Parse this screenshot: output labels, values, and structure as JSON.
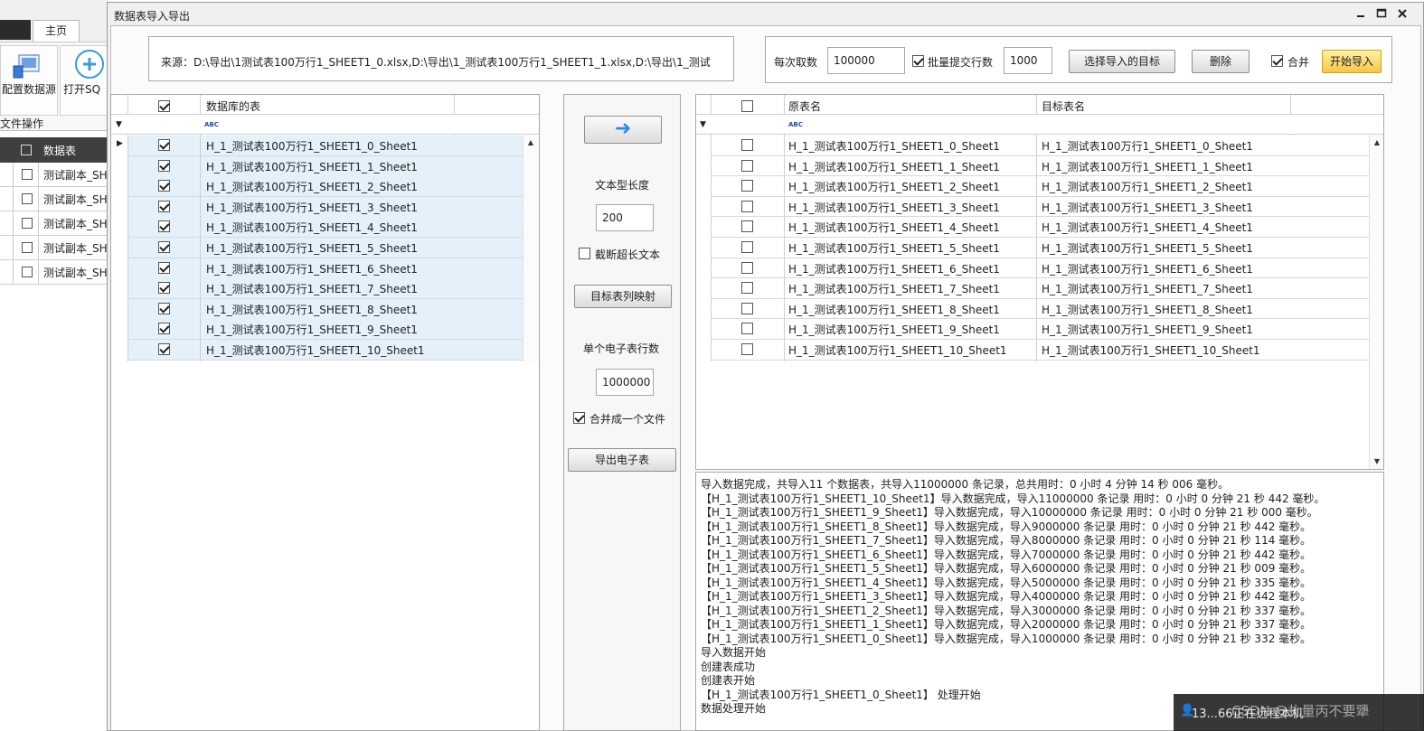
{
  "bg_app": {
    "tab_home": "主页",
    "btn_config": "配置数据源",
    "btn_open": "打开SQ",
    "group_label": "文件操作",
    "grid_header": "数据表",
    "rows": [
      "测试副本_SH",
      "测试副本_SH",
      "测试副本_SH",
      "测试副本_SH",
      "测试副本_SH"
    ]
  },
  "dialog": {
    "title": "数据表导入导出",
    "source_label": "来源：D:\\导出\\1测试表100万行1_SHEET1_0.xlsx,D:\\导出\\1_测试表100万行1_SHEET1_1.xlsx,D:\\导出\\1_测试",
    "batch_label": "每次取数",
    "batch_value": "100000",
    "bulk_label": "批量提交行数",
    "bulk_value": "1000",
    "choose_target": "选择导入的目标",
    "delete": "删除",
    "merge_label": "合并",
    "start_import": "开始导入"
  },
  "left_grid": {
    "header": "数据库的表",
    "rows": [
      "H_1_测试表100万行1_SHEET1_0_Sheet1",
      "H_1_测试表100万行1_SHEET1_1_Sheet1",
      "H_1_测试表100万行1_SHEET1_2_Sheet1",
      "H_1_测试表100万行1_SHEET1_3_Sheet1",
      "H_1_测试表100万行1_SHEET1_4_Sheet1",
      "H_1_测试表100万行1_SHEET1_5_Sheet1",
      "H_1_测试表100万行1_SHEET1_6_Sheet1",
      "H_1_测试表100万行1_SHEET1_7_Sheet1",
      "H_1_测试表100万行1_SHEET1_8_Sheet1",
      "H_1_测试表100万行1_SHEET1_9_Sheet1",
      "H_1_测试表100万行1_SHEET1_10_Sheet1"
    ]
  },
  "middle": {
    "arrow": "➜",
    "text_length_label": "文本型长度",
    "text_length_value": "200",
    "truncate_label": "截断超长文本",
    "column_map": "目标表列映射",
    "rows_per_sheet_label": "单个电子表行数",
    "rows_per_sheet_value": "1000000",
    "merge_file_label": "合并成一个文件",
    "export": "导出电子表"
  },
  "right_grid": {
    "header_source": "原表名",
    "header_target": "目标表名",
    "rows": [
      [
        "H_1_测试表100万行1_SHEET1_0_Sheet1",
        "H_1_测试表100万行1_SHEET1_0_Sheet1"
      ],
      [
        "H_1_测试表100万行1_SHEET1_1_Sheet1",
        "H_1_测试表100万行1_SHEET1_1_Sheet1"
      ],
      [
        "H_1_测试表100万行1_SHEET1_2_Sheet1",
        "H_1_测试表100万行1_SHEET1_2_Sheet1"
      ],
      [
        "H_1_测试表100万行1_SHEET1_3_Sheet1",
        "H_1_测试表100万行1_SHEET1_3_Sheet1"
      ],
      [
        "H_1_测试表100万行1_SHEET1_4_Sheet1",
        "H_1_测试表100万行1_SHEET1_4_Sheet1"
      ],
      [
        "H_1_测试表100万行1_SHEET1_5_Sheet1",
        "H_1_测试表100万行1_SHEET1_5_Sheet1"
      ],
      [
        "H_1_测试表100万行1_SHEET1_6_Sheet1",
        "H_1_测试表100万行1_SHEET1_6_Sheet1"
      ],
      [
        "H_1_测试表100万行1_SHEET1_7_Sheet1",
        "H_1_测试表100万行1_SHEET1_7_Sheet1"
      ],
      [
        "H_1_测试表100万行1_SHEET1_8_Sheet1",
        "H_1_测试表100万行1_SHEET1_8_Sheet1"
      ],
      [
        "H_1_测试表100万行1_SHEET1_9_Sheet1",
        "H_1_测试表100万行1_SHEET1_9_Sheet1"
      ],
      [
        "H_1_测试表100万行1_SHEET1_10_Sheet1",
        "H_1_测试表100万行1_SHEET1_10_Sheet1"
      ]
    ]
  },
  "log": [
    "导入数据完成，共导入11 个数据表，共导入11000000 条记录，总共用时：0 小时 4 分钟 14 秒 006 毫秒。",
    "【H_1_测试表100万行1_SHEET1_10_Sheet1】导入数据完成，导入11000000 条记录 用时：0 小时 0 分钟 21 秒 442 毫秒。",
    "【H_1_测试表100万行1_SHEET1_9_Sheet1】导入数据完成，导入10000000 条记录 用时：0 小时 0 分钟 21 秒 000 毫秒。",
    "【H_1_测试表100万行1_SHEET1_8_Sheet1】导入数据完成，导入9000000 条记录 用时：0 小时 0 分钟 21 秒 442 毫秒。",
    "【H_1_测试表100万行1_SHEET1_7_Sheet1】导入数据完成，导入8000000 条记录 用时：0 小时 0 分钟 21 秒 114 毫秒。",
    "【H_1_测试表100万行1_SHEET1_6_Sheet1】导入数据完成，导入7000000 条记录 用时：0 小时 0 分钟 21 秒 442 毫秒。",
    "【H_1_测试表100万行1_SHEET1_5_Sheet1】导入数据完成，导入6000000 条记录 用时：0 小时 0 分钟 21 秒 009 毫秒。",
    "【H_1_测试表100万行1_SHEET1_4_Sheet1】导入数据完成，导入5000000 条记录 用时：0 小时 0 分钟 21 秒 335 毫秒。",
    "【H_1_测试表100万行1_SHEET1_3_Sheet1】导入数据完成，导入4000000 条记录 用时：0 小时 0 分钟 21 秒 442 毫秒。",
    "【H_1_测试表100万行1_SHEET1_2_Sheet1】导入数据完成，导入3000000 条记录 用时：0 小时 0 分钟 21 秒 337 毫秒。",
    "【H_1_测试表100万行1_SHEET1_1_Sheet1】导入数据完成，导入2000000 条记录 用时：0 小时 0 分钟 21 秒 337 毫秒。",
    "【H_1_测试表100万行1_SHEET1_0_Sheet1】导入数据完成，导入1000000 条记录 用时：0 小时 0 分钟 21 秒 332 毫秒。",
    " 导入数据开始",
    " 创建表成功",
    " 创建表开始",
    "【H_1_测试表100万行1_SHEET1_0_Sheet1】 处理开始",
    "数据处理开始"
  ],
  "overlay": {
    "text": "13...66正在远程本机",
    "watermark": "CSDN @扎量丙不要犟"
  }
}
